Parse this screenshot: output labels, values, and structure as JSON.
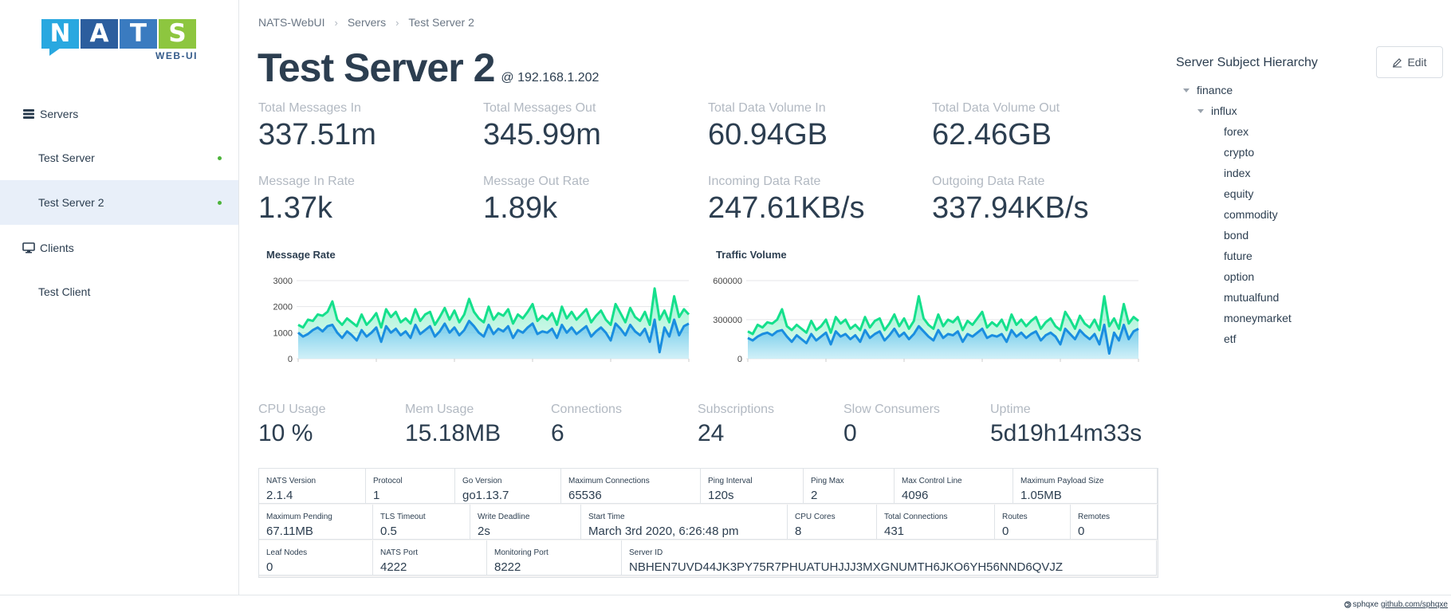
{
  "colors": {
    "accent": "#2c3e50",
    "online": "#4cb43b",
    "active_bg": "#e8eff9",
    "series_in": "#15e08c",
    "series_out": "#1a8ee0",
    "logo_n": "#29a8e0",
    "logo_a": "#2c5e9e",
    "logo_t": "#3a7bc0",
    "logo_s": "#8dc63f"
  },
  "logo": {
    "letters": [
      "N",
      "A",
      "T",
      "S"
    ],
    "sub": "WEB-UI"
  },
  "sidebar": {
    "groups": [
      {
        "label": "Servers",
        "icon": "server-icon"
      },
      {
        "label": "Clients",
        "icon": "monitor-icon"
      }
    ],
    "servers": [
      {
        "label": "Test Server",
        "online": true
      },
      {
        "label": "Test Server 2",
        "online": true,
        "active": true
      }
    ],
    "clients": [
      {
        "label": "Test Client"
      }
    ]
  },
  "breadcrumb": [
    "NATS-WebUI",
    "Servers",
    "Test Server 2"
  ],
  "header": {
    "title": "Test Server 2",
    "ip": "@ 192.168.1.202"
  },
  "stats_top": [
    {
      "label": "Total Messages In",
      "value": "337.51m"
    },
    {
      "label": "Total Messages Out",
      "value": "345.99m"
    },
    {
      "label": "Total Data Volume In",
      "value": "60.94GB"
    },
    {
      "label": "Total Data Volume Out",
      "value": "62.46GB"
    },
    {
      "label": "Message In Rate",
      "value": "1.37k"
    },
    {
      "label": "Message Out Rate",
      "value": "1.89k"
    },
    {
      "label": "Incoming Data Rate",
      "value": "247.61KB/s"
    },
    {
      "label": "Outgoing Data Rate",
      "value": "337.94KB/s"
    }
  ],
  "chart_data": [
    {
      "type": "area",
      "title": "Message Rate",
      "yticks": [
        "3000",
        "2000",
        "1000",
        "0"
      ],
      "ylim": [
        0,
        3000
      ],
      "grid": true,
      "series": [
        {
          "values": [
            1300,
            1200,
            1500,
            1450,
            1700,
            1650,
            1800,
            2200,
            1500,
            1300,
            1550,
            1400,
            1250,
            1700,
            1300,
            1500,
            1750,
            1200,
            1900,
            1600,
            1800,
            1400,
            1550,
            1350,
            1900,
            1450,
            1700,
            1800,
            1300,
            1600,
            1950,
            1500,
            1850,
            1400,
            1700,
            2300,
            1800,
            1550,
            1400,
            2000,
            1500,
            1750,
            1650,
            1900,
            1350,
            1700,
            1550,
            1800,
            2100,
            1450,
            1650,
            1500,
            1750,
            1300,
            2000,
            1550,
            1800,
            1500,
            1700,
            1900,
            1400,
            1650,
            1850,
            1500,
            1300,
            2100,
            1750,
            1400,
            1950,
            1600,
            1450,
            1800,
            1300,
            2700,
            1500,
            1850,
            1400,
            2400,
            1600,
            1900,
            1700
          ]
        },
        {
          "values": [
            1000,
            850,
            950,
            1100,
            1200,
            1050,
            1250,
            1300,
            1000,
            800,
            1050,
            900,
            700,
            1100,
            850,
            1000,
            1200,
            650,
            1250,
            1000,
            1150,
            900,
            1050,
            800,
            1300,
            950,
            1100,
            1250,
            850,
            1050,
            1350,
            1000,
            1200,
            900,
            1100,
            1450,
            1250,
            1000,
            850,
            1300,
            950,
            1150,
            1050,
            1250,
            800,
            1100,
            1000,
            1200,
            1350,
            950,
            1050,
            1000,
            1150,
            800,
            1300,
            1000,
            1200,
            950,
            1100,
            1250,
            850,
            1050,
            1200,
            1000,
            700,
            1350,
            1150,
            900,
            1300,
            1050,
            900,
            1150,
            650,
            1500,
            250,
            1200,
            850,
            1500,
            900,
            1250,
            1350
          ]
        }
      ]
    },
    {
      "type": "area",
      "title": "Traffic Volume",
      "yticks": [
        "600000",
        "300000",
        "0"
      ],
      "ylim": [
        0,
        600000
      ],
      "grid": true,
      "series": [
        {
          "values": [
            210000,
            190000,
            260000,
            240000,
            280000,
            270000,
            300000,
            380000,
            250000,
            220000,
            260000,
            230000,
            200000,
            290000,
            220000,
            250000,
            300000,
            200000,
            320000,
            270000,
            300000,
            230000,
            260000,
            220000,
            320000,
            240000,
            290000,
            310000,
            220000,
            270000,
            340000,
            250000,
            310000,
            230000,
            290000,
            480000,
            310000,
            260000,
            230000,
            340000,
            250000,
            300000,
            280000,
            320000,
            220000,
            290000,
            260000,
            310000,
            360000,
            240000,
            280000,
            250000,
            300000,
            220000,
            340000,
            260000,
            300000,
            250000,
            290000,
            320000,
            230000,
            280000,
            310000,
            250000,
            220000,
            360000,
            300000,
            230000,
            330000,
            270000,
            240000,
            300000,
            220000,
            480000,
            250000,
            310000,
            230000,
            420000,
            270000,
            320000,
            290000
          ]
        },
        {
          "values": [
            160000,
            140000,
            170000,
            190000,
            200000,
            180000,
            210000,
            220000,
            170000,
            130000,
            180000,
            150000,
            120000,
            190000,
            140000,
            170000,
            200000,
            110000,
            210000,
            170000,
            190000,
            150000,
            180000,
            130000,
            220000,
            160000,
            190000,
            210000,
            140000,
            180000,
            230000,
            170000,
            200000,
            150000,
            190000,
            250000,
            210000,
            170000,
            140000,
            220000,
            160000,
            190000,
            180000,
            210000,
            130000,
            190000,
            170000,
            200000,
            230000,
            160000,
            180000,
            170000,
            190000,
            130000,
            220000,
            170000,
            200000,
            160000,
            190000,
            210000,
            140000,
            180000,
            200000,
            170000,
            110000,
            230000,
            190000,
            150000,
            220000,
            180000,
            150000,
            190000,
            110000,
            260000,
            40000,
            200000,
            140000,
            260000,
            150000,
            210000,
            230000
          ]
        }
      ]
    }
  ],
  "stats_mid": [
    {
      "label": "CPU Usage",
      "value": "10 %"
    },
    {
      "label": "Mem Usage",
      "value": "15.18MB"
    },
    {
      "label": "Connections",
      "value": "6"
    },
    {
      "label": "Subscriptions",
      "value": "24"
    },
    {
      "label": "Slow Consumers",
      "value": "0"
    },
    {
      "label": "Uptime",
      "value": "5d19h14m33s"
    }
  ],
  "info": [
    [
      {
        "label": "NATS Version",
        "value": "2.1.4"
      },
      {
        "label": "Protocol",
        "value": "1"
      },
      {
        "label": "Go Version",
        "value": "go1.13.7"
      },
      {
        "label": "Maximum Connections",
        "value": "65536"
      },
      {
        "label": "Ping Interval",
        "value": "120s"
      },
      {
        "label": "Ping Max",
        "value": "2"
      },
      {
        "label": "Max Control Line",
        "value": "4096"
      },
      {
        "label": "Maximum Payload Size",
        "value": "1.05MB"
      }
    ],
    [
      {
        "label": "Maximum Pending",
        "value": "67.11MB"
      },
      {
        "label": "TLS Timeout",
        "value": "0.5"
      },
      {
        "label": "Write Deadline",
        "value": "2s"
      },
      {
        "label": "Start Time",
        "value": "March 3rd 2020, 6:26:48 pm"
      },
      {
        "label": "CPU Cores",
        "value": "8"
      },
      {
        "label": "Total Connections",
        "value": "431"
      },
      {
        "label": "Routes",
        "value": "0"
      },
      {
        "label": "Remotes",
        "value": "0"
      }
    ],
    [
      {
        "label": "Leaf Nodes",
        "value": "0"
      },
      {
        "label": "NATS Port",
        "value": "4222"
      },
      {
        "label": "Monitoring Port",
        "value": "8222"
      },
      {
        "label": "Server ID",
        "value": "NBHEN7UVD44JK3PY75R7PHUATUHJJJ3MXGNUMTH6JKO6YH56NND6QVJZ"
      }
    ]
  ],
  "hierarchy": {
    "title": "Server Subject Hierarchy",
    "edit_label": "Edit",
    "root": "finance",
    "child": "influx",
    "leaves": [
      "forex",
      "crypto",
      "index",
      "equity",
      "commodity",
      "bond",
      "future",
      "option",
      "mutualfund",
      "moneymarket",
      "etf"
    ]
  },
  "footer": {
    "author": "sphqxe",
    "link": "github.com/sphqxe"
  }
}
